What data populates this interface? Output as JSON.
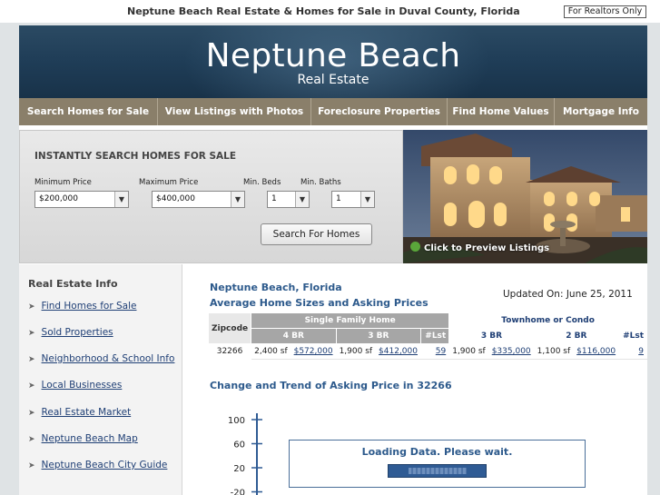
{
  "top_bar": {
    "title": "Neptune Beach Real Estate & Homes for Sale in Duval County, Florida",
    "realtors_link": "For Realtors Only"
  },
  "banner": {
    "title": "Neptune Beach",
    "subtitle": "Real Estate"
  },
  "nav": {
    "items": [
      {
        "label": "Search Homes for Sale"
      },
      {
        "label": "View Listings with Photos"
      },
      {
        "label": "Foreclosure Properties"
      },
      {
        "label": "Find Home Values"
      },
      {
        "label": "Mortgage Info"
      }
    ]
  },
  "search": {
    "heading": "INSTANTLY SEARCH HOMES FOR SALE",
    "min_price_label": "Minimum Price",
    "min_price_value": "$200,000",
    "max_price_label": "Maximum Price",
    "max_price_value": "$400,000",
    "min_beds_label": "Min. Beds",
    "min_beds_value": "1",
    "min_baths_label": "Min. Baths",
    "min_baths_value": "1",
    "button_label": "Search For Homes"
  },
  "photo": {
    "preview_label": "Click to Preview Listings"
  },
  "sidebar": {
    "title": "Real Estate Info",
    "items": [
      {
        "label": "Find Homes for Sale"
      },
      {
        "label": "Sold Properties"
      },
      {
        "label": "Neighborhood & School Info"
      },
      {
        "label": "Local Businesses"
      },
      {
        "label": "Real Estate Market"
      },
      {
        "label": "Neptune Beach Map"
      },
      {
        "label": "Neptune Beach City Guide"
      }
    ]
  },
  "content": {
    "location_title": "Neptune Beach, Florida",
    "subtitle": "Average Home Sizes and Asking Prices",
    "updated": "Updated On: June 25, 2011",
    "trend_title": "Change and Trend of Asking Price in 32266",
    "loading_text": "Loading Data. Please wait."
  },
  "table": {
    "zip_header": "Zipcode",
    "group_single": "Single Family Home",
    "group_town": "Townhome or Condo",
    "sub_headers": [
      "4 BR",
      "3 BR",
      "#Lst",
      "3 BR",
      "2 BR",
      "#Lst"
    ],
    "row": {
      "zip": "32266",
      "sf4_size": "2,400 sf",
      "sf4_price": "$572,000",
      "sf3_size": "1,900 sf",
      "sf3_price": "$412,000",
      "sf_lst": "59",
      "tc3_size": "1,900 sf",
      "tc3_price": "$335,000",
      "tc2_size": "1,100 sf",
      "tc2_price": "$116,000",
      "tc_lst": "9"
    }
  },
  "chart_data": {
    "type": "line",
    "title": "Change and Trend of Asking Price in 32266",
    "yticks": [
      "100",
      "60",
      "20",
      "-20"
    ],
    "ylim": [
      -20,
      100
    ],
    "series": []
  },
  "colors": {
    "banner": "#1f3d57",
    "nav": "#8a7f6a",
    "link": "#1f3f75",
    "heading": "#2d5a8c"
  }
}
